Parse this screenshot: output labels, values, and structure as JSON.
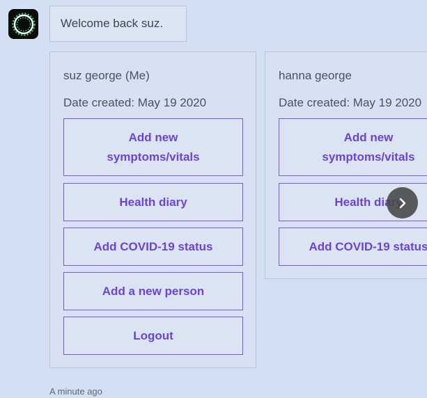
{
  "welcome": {
    "text": "Welcome back suz."
  },
  "cards": [
    {
      "name": "suz george (Me)",
      "date": "Date created: May 19 2020",
      "buttons": {
        "add_symptoms": "Add new symptoms/vitals",
        "health_diary": "Health diary",
        "covid_status": "Add COVID-19 status",
        "add_person": "Add a new person",
        "logout": "Logout"
      }
    },
    {
      "name": "hanna george",
      "date": "Date created: May 19 2020",
      "buttons": {
        "add_symptoms": "Add new symptoms/vitals",
        "health_diary": "Health diary",
        "covid_status": "Add COVID-19 status"
      }
    }
  ],
  "timestamp": "A minute ago",
  "icons": {
    "avatar": "bot-avatar-icon",
    "next": "chevron-right-icon"
  },
  "colors": {
    "background": "#d3dff2",
    "button_border": "#7b56d6",
    "button_text": "#6d43d3",
    "avatar_ring": "#39d46a"
  }
}
